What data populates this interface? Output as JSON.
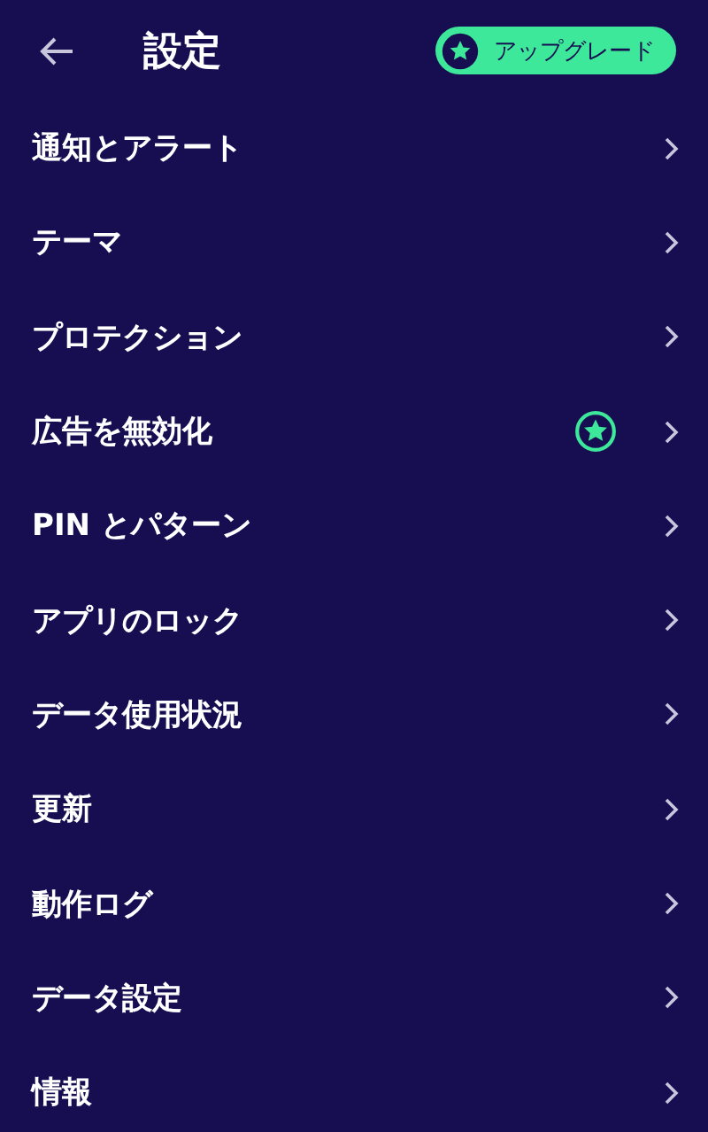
{
  "header": {
    "title": "設定",
    "upgrade_label": "アップグレード"
  },
  "items": [
    {
      "label": "通知とアラート",
      "premium": false
    },
    {
      "label": "テーマ",
      "premium": false
    },
    {
      "label": "プロテクション",
      "premium": false
    },
    {
      "label": "広告を無効化",
      "premium": true
    },
    {
      "label": "PIN とパターン",
      "premium": false
    },
    {
      "label": "アプリのロック",
      "premium": false
    },
    {
      "label": "データ使用状況",
      "premium": false
    },
    {
      "label": "更新",
      "premium": false
    },
    {
      "label": "動作ログ",
      "premium": false
    },
    {
      "label": "データ設定",
      "premium": false
    },
    {
      "label": "情報",
      "premium": false
    }
  ]
}
